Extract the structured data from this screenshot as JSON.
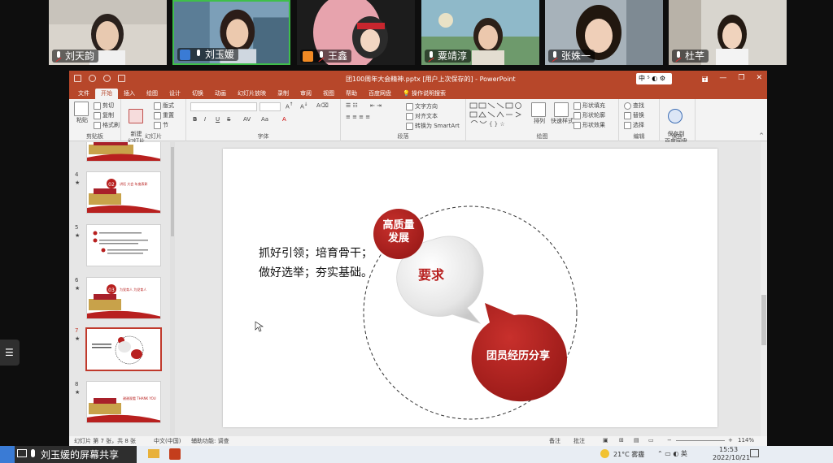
{
  "participants": [
    {
      "name": "刘天韵",
      "mic": "muted",
      "role": ""
    },
    {
      "name": "刘玉媛",
      "mic": "on",
      "role": "host",
      "speaking": true
    },
    {
      "name": "王鑫",
      "mic": "muted",
      "role": "guest"
    },
    {
      "name": "粟靖淳",
      "mic": "muted",
      "role": ""
    },
    {
      "name": "张姝一",
      "mic": "muted",
      "role": ""
    },
    {
      "name": "杜芊",
      "mic": "muted",
      "role": ""
    }
  ],
  "ppt": {
    "doc_title": "团100周年大会精神.pptx [用户上次保存的] - PowerPoint",
    "ime_label": "中 ⁵ ◐ ⚙",
    "window_buttons": [
      "🖬",
      "—",
      "❐",
      "✕"
    ],
    "tabs": [
      "文件",
      "开始",
      "插入",
      "绘图",
      "设计",
      "切换",
      "动画",
      "幻灯片放映",
      "录制",
      "审阅",
      "视图",
      "帮助",
      "百度网盘",
      "💡 操作说明搜索"
    ],
    "selected_tab": "开始",
    "ribbon": {
      "clipboard": {
        "paste": "粘贴",
        "cut": "剪切",
        "copy": "复制",
        "format_painter": "格式刷",
        "label": "剪贴板"
      },
      "slides": {
        "new_slide": "新建\n幻灯片",
        "layout": "版式",
        "reset": "重置",
        "section": "节",
        "label": "幻灯片"
      },
      "font": {
        "bold": "B",
        "italic": "I",
        "underline": "U",
        "strike": "S",
        "label": "字体"
      },
      "paragraph": {
        "text_direction": "文字方向",
        "align_text": "对齐文本",
        "smartart": "转换为 SmartArt",
        "label": "段落"
      },
      "drawing": {
        "arrange": "排列",
        "quick_styles": "快速样式",
        "fill": "形状填充",
        "outline": "形状轮廓",
        "effects": "形状效果",
        "label": "绘图"
      },
      "editing": {
        "find": "查找",
        "replace": "替换",
        "select": "选择",
        "label": "编辑"
      },
      "save": {
        "save_to_baidu": "保存到\n百度网盘",
        "label": "保存"
      }
    },
    "thumbnails": [
      {
        "num": "",
        "star": "",
        "kind": "tiananmen-banner"
      },
      {
        "num": "4",
        "star": "★",
        "kind": "section-02",
        "badge": "02",
        "caption": "讲话 大会 年度表彰"
      },
      {
        "num": "5",
        "star": "★",
        "kind": "text-list"
      },
      {
        "num": "6",
        "star": "★",
        "kind": "section-03",
        "badge": "03",
        "caption": "为党育人 为党育人"
      },
      {
        "num": "7",
        "star": "★",
        "kind": "current-slide",
        "selected": true
      },
      {
        "num": "8",
        "star": "★",
        "kind": "thanks",
        "caption": "谢谢观看 THANK YOU"
      }
    ],
    "slide": {
      "line1": "抓好引领；培育骨干；",
      "line2": "做好选举；夯实基础。",
      "bubble_top": "高质量\n发展",
      "bubble_center": "要求",
      "bubble_bottom": "团员经历分享",
      "colors": {
        "red": "#b8201f",
        "gray_bubble": "#ececec",
        "dash_circle": "#333333"
      }
    },
    "status": {
      "slide_pos": "幻灯片 第 7 张，共 8 张",
      "language": "中文(中国)",
      "accessibility": "辅助功能: 调查",
      "notes": "备注",
      "comments": "批注",
      "zoom": "114%"
    }
  },
  "share_bar": {
    "label": "刘玉媛的屏幕共享"
  },
  "taskbar": {
    "weather": "21°C 雾霾",
    "time": "15:53",
    "date": "2022/10/21"
  }
}
